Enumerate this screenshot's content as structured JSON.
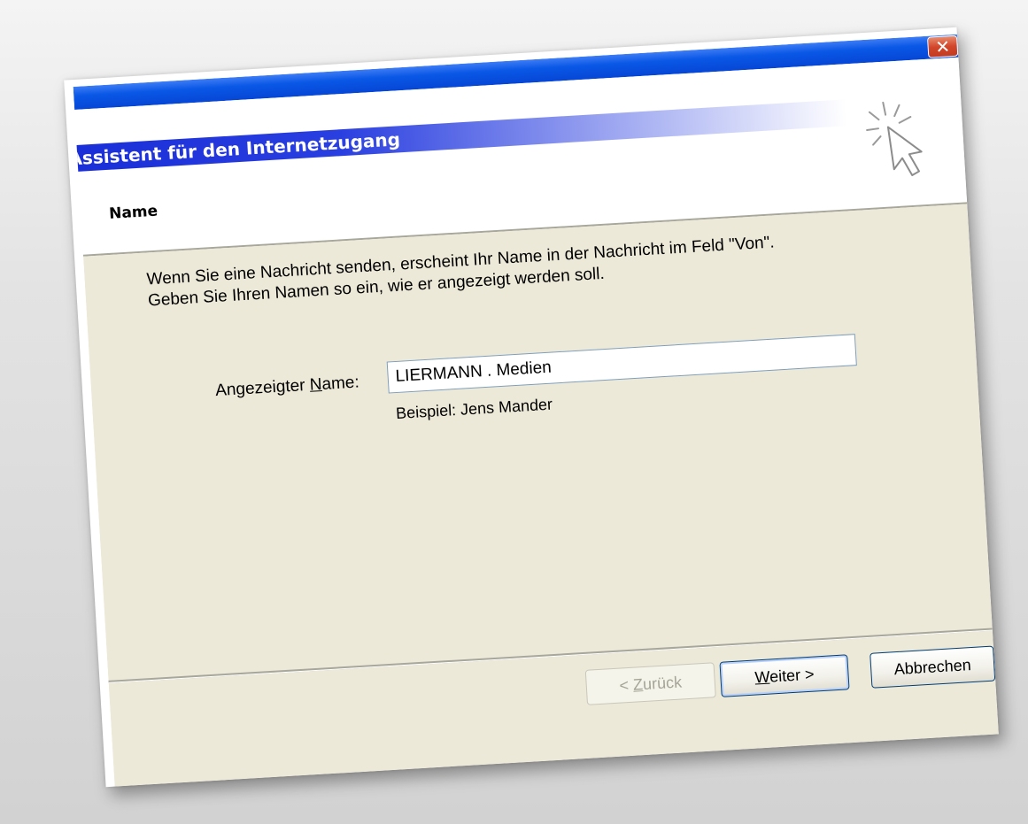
{
  "window": {
    "close_glyph": "✕",
    "close_color": "#d2462b",
    "titlebar_color": "#0a58e6"
  },
  "wizard": {
    "title": "Assistent für den Internetzugang",
    "icon": "cursor-click-icon",
    "page_heading": "Name"
  },
  "content": {
    "description_line1": "Wenn Sie eine Nachricht senden, erscheint Ihr Name in der Nachricht im Feld \"Von\".",
    "description_line2": "Geben Sie Ihren Namen so ein, wie er angezeigt werden soll.",
    "field_label_pre": "Angezeigter ",
    "field_label_mnemonic": "N",
    "field_label_post": "ame:",
    "field_value": "LIERMANN . Medien",
    "example": "Beispiel: Jens Mander",
    "background_color": "#ece9d8"
  },
  "buttons": {
    "back_pre": "< ",
    "back_mnemonic": "Z",
    "back_post": "urück",
    "back_enabled": false,
    "next_mnemonic": "W",
    "next_post": "eiter >",
    "cancel_label": "Abbrechen"
  }
}
